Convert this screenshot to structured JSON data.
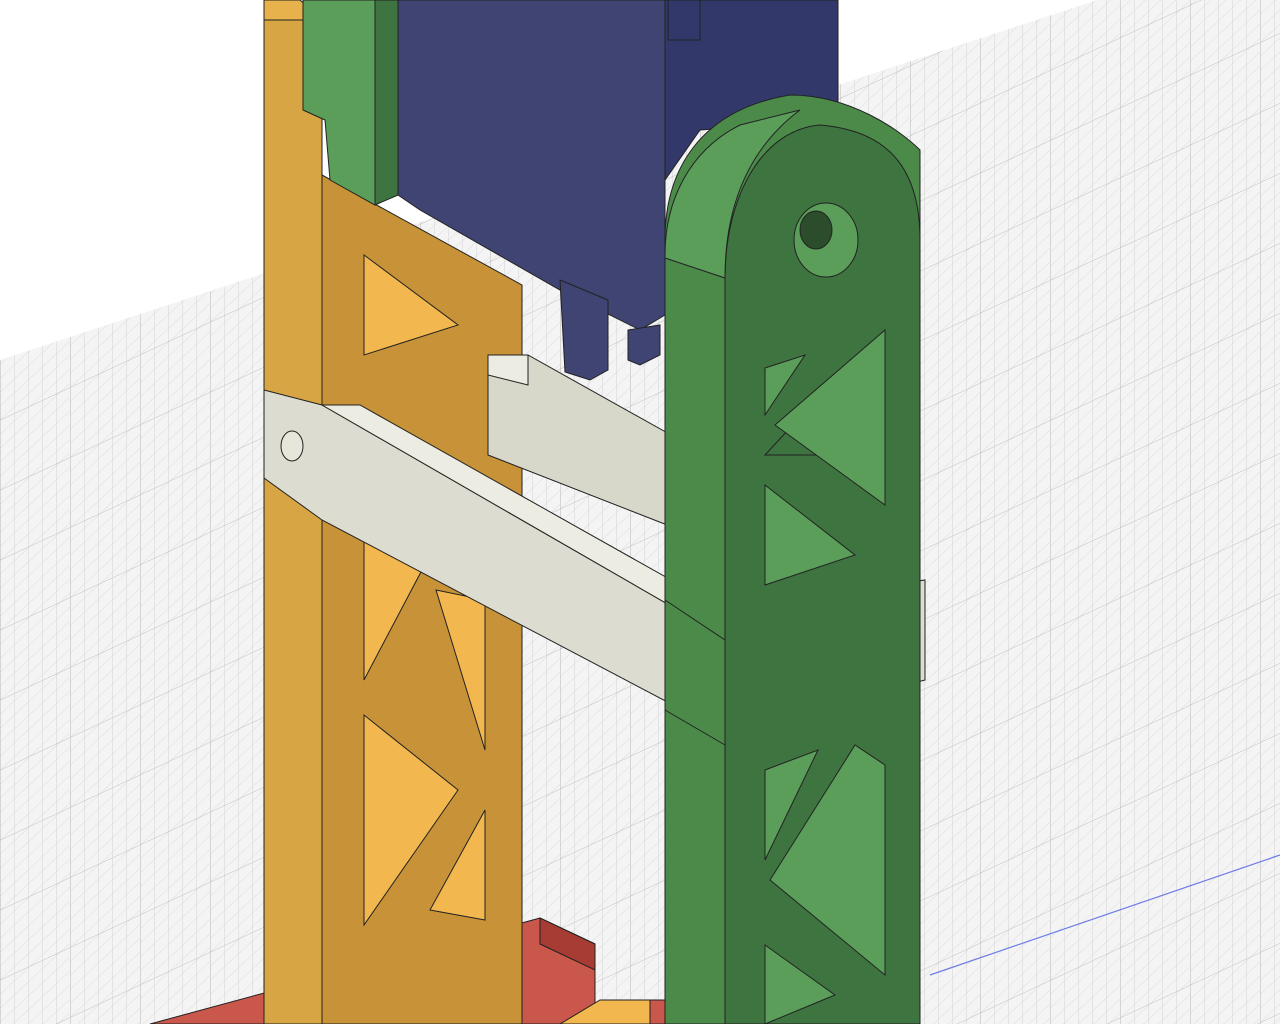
{
  "viewport": {
    "type": "3d-cad-canvas",
    "background_color": "#ffffff",
    "grid_color": "#c9c9c9",
    "grid_major_color": "#b5b5b5",
    "axis_color": "#5a6be0"
  },
  "parts": [
    {
      "name": "yellow-truss-frame",
      "color": "#f2b84f",
      "shade": "#d8a544",
      "dark": "#c89338"
    },
    {
      "name": "green-truss-link",
      "color": "#5a9e5a",
      "shade": "#4c8a4a",
      "dark": "#3e7440"
    },
    {
      "name": "blue-servo",
      "color": "#3f4472",
      "shade": "#33386a",
      "dark": "#2b2f5e"
    },
    {
      "name": "white-crossbar",
      "color": "#dcdcd0",
      "shade": "#cfcfc2",
      "dark": "#bdbdb0"
    },
    {
      "name": "red-base-plate",
      "color": "#c9574b",
      "shade": "#a63c33"
    },
    {
      "name": "green-upper-bracket",
      "color": "#5a9e5a",
      "shade": "#3e7440"
    }
  ]
}
